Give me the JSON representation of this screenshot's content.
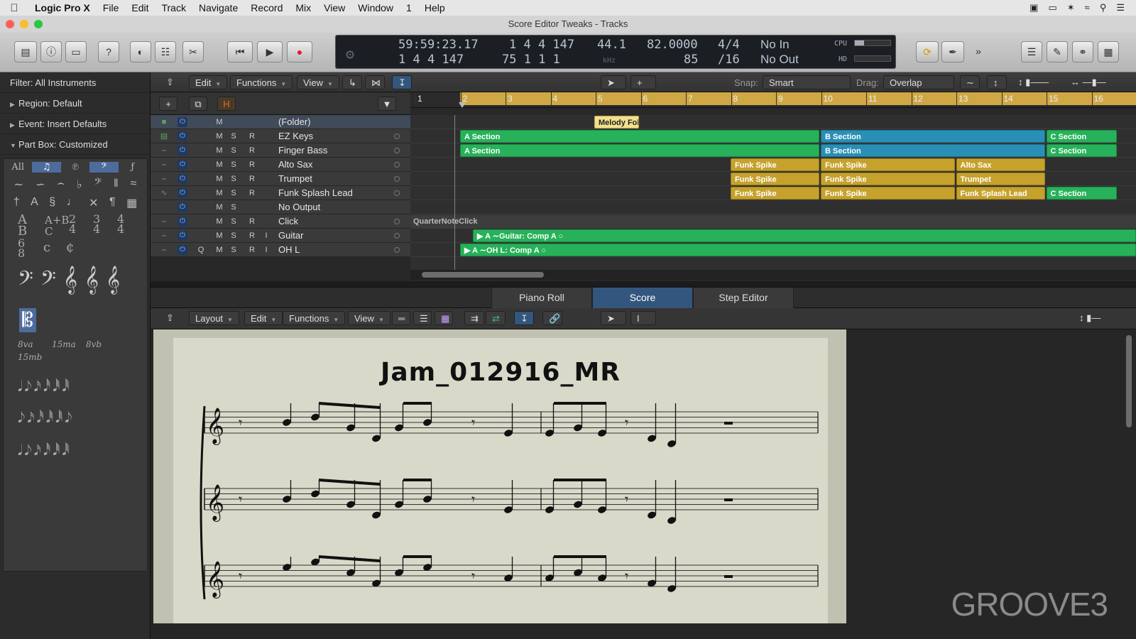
{
  "menubar": {
    "app": "Logic Pro X",
    "items": [
      "File",
      "Edit",
      "Track",
      "Navigate",
      "Record",
      "Mix",
      "View",
      "Window",
      "1",
      "Help"
    ]
  },
  "window": {
    "title": "Score Editor Tweaks - Tracks"
  },
  "lcd": {
    "time": "59:59:23.17",
    "time_sub": "1  4  4  147",
    "bars": "1  4  4  147",
    "bars_sub": "75  1  1     1",
    "sample_rate": "44.1",
    "sample_unit": "kHz",
    "tempo": "82.0000",
    "tempo_sub": "85",
    "sig": "4/4",
    "sig_sub": "/16",
    "in": "No In",
    "out": "No Out",
    "cpu": "CPU",
    "hd": "HD"
  },
  "inspector": {
    "filter": "Filter: All Instruments",
    "region": "Region:  Default",
    "event": "Event:  Insert Defaults",
    "partbox": "Part Box:  Customized",
    "partbox_all": "All",
    "octave_labels": [
      "8va",
      "15ma",
      "8vb",
      "15mb"
    ]
  },
  "tracks_toolbar": {
    "edit": "Edit",
    "functions": "Functions",
    "view": "View",
    "snap_label": "Snap:",
    "snap_value": "Smart",
    "drag_label": "Drag:",
    "drag_value": "Overlap"
  },
  "tracks": [
    {
      "name": "(Folder)",
      "buttons": [
        "M"
      ]
    },
    {
      "name": "EZ Keys",
      "buttons": [
        "M",
        "S",
        "R"
      ]
    },
    {
      "name": "Finger Bass",
      "buttons": [
        "M",
        "S",
        "R"
      ]
    },
    {
      "name": "Alto Sax",
      "buttons": [
        "M",
        "S",
        "R"
      ]
    },
    {
      "name": "Trumpet",
      "buttons": [
        "M",
        "S",
        "R"
      ]
    },
    {
      "name": "Funk Splash Lead",
      "buttons": [
        "M",
        "S",
        "R"
      ]
    },
    {
      "name": "No Output",
      "buttons": [
        "M",
        "S"
      ]
    },
    {
      "name": "Click",
      "buttons": [
        "M",
        "S",
        "R"
      ]
    },
    {
      "name": "Guitar",
      "buttons": [
        "M",
        "S",
        "R",
        "I"
      ]
    },
    {
      "name": "OH L",
      "buttons": [
        "Q",
        "M",
        "S",
        "R",
        "I"
      ]
    }
  ],
  "ruler": [
    "1",
    "2",
    "3",
    "4",
    "5",
    "6",
    "7",
    "8",
    "9",
    "10",
    "11",
    "12",
    "13",
    "14",
    "15",
    "16"
  ],
  "regions": {
    "melody_folder": "Melody Folder",
    "a_section": "A Section",
    "b_section": "B Section",
    "c_section": "C Section",
    "funk_spike": "Funk Spike",
    "alto_sax": "Alto Sax",
    "trumpet": "Trumpet",
    "funk_splash_lead": "Funk Splash Lead",
    "quarter_note_click": "QuarterNoteClick",
    "guitar_comp": "Guitar: Comp A",
    "ohl_comp": "OH L: Comp A",
    "take_letter": "A"
  },
  "editor_tabs": [
    "Piano Roll",
    "Score",
    "Step Editor"
  ],
  "score_toolbar": {
    "layout": "Layout",
    "edit": "Edit",
    "functions": "Functions",
    "view": "View"
  },
  "score": {
    "title": "Jam_012916_MR"
  },
  "watermark": {
    "text": "GROOVE",
    "num": "3"
  }
}
